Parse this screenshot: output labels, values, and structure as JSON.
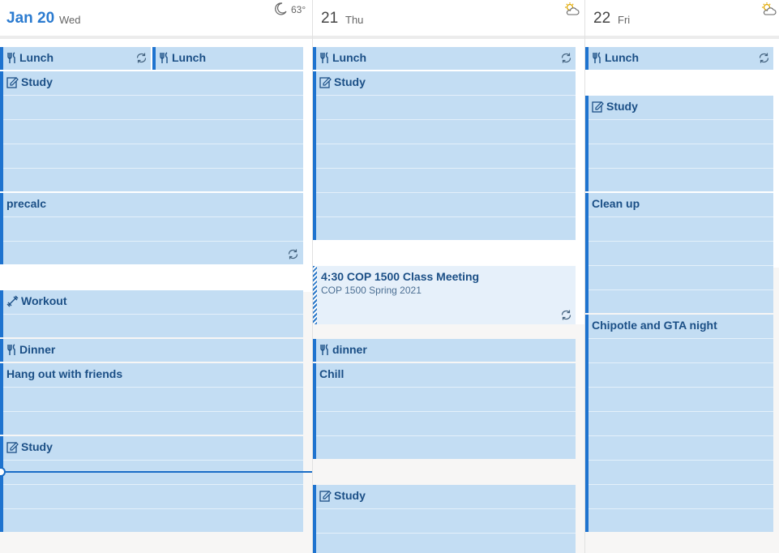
{
  "days": [
    {
      "num": "Jan 20",
      "name": "Wed",
      "temp": "63°",
      "weather_icon": "moon-icon",
      "today": true
    },
    {
      "num": "21",
      "name": "Thu",
      "temp": "",
      "weather_icon": "partly-cloudy-icon"
    },
    {
      "num": "22",
      "name": "Fri",
      "temp": "",
      "weather_icon": "partly-cloudy-icon"
    }
  ],
  "events": {
    "wed": {
      "lunch_a": "Lunch",
      "lunch_b": "Lunch",
      "study1": "Study",
      "precalc": "precalc",
      "workout": "Workout",
      "dinner": "Dinner",
      "hangout": "Hang out with friends",
      "study2": "Study"
    },
    "thu": {
      "lunch": "Lunch",
      "study": "Study",
      "meeting": "4:30 COP 1500 Class Meeting",
      "meeting_sub": "COP 1500 Spring 2021",
      "dinner": "dinner",
      "chill": "Chill",
      "study2": "Study"
    },
    "fri": {
      "lunch": "Lunch",
      "study": "Study",
      "cleanup": "Clean up",
      "chipotle": "Chipotle and GTA night"
    }
  },
  "colors": {
    "event_bg": "#c3ddf3",
    "accent": "#1e73cf",
    "text": "#1b4f86"
  }
}
